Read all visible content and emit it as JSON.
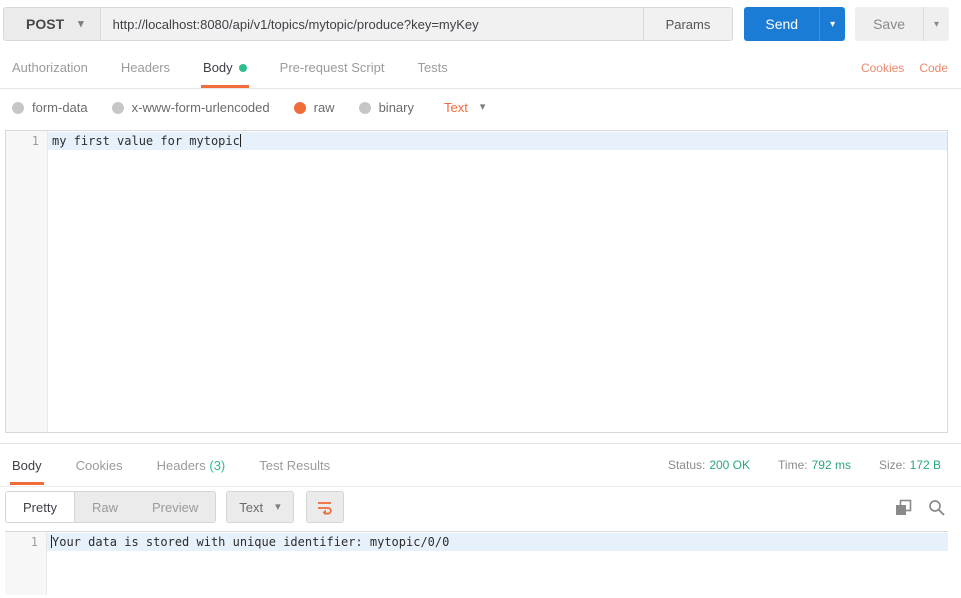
{
  "colors": {
    "accent_orange": "#f26b3a",
    "send_blue": "#1b7cd6",
    "green": "#2dbe8d"
  },
  "icons": {
    "caret_down": "▾"
  },
  "request_bar": {
    "method": "POST",
    "url": "http://localhost:8080/api/v1/topics/mytopic/produce?key=myKey",
    "params_label": "Params",
    "send_label": "Send",
    "save_label": "Save"
  },
  "request_tabs": {
    "authorization": "Authorization",
    "headers": "Headers",
    "body": "Body",
    "pre_request": "Pre-request Script",
    "tests": "Tests",
    "cookies_link": "Cookies",
    "code_link": "Code"
  },
  "body_type": {
    "form_data": "form-data",
    "urlencoded": "x-www-form-urlencoded",
    "raw": "raw",
    "binary": "binary",
    "selected": "raw",
    "format_selected": "Text"
  },
  "request_editor": {
    "line_number": "1",
    "content": "my first value for mytopic"
  },
  "response": {
    "tabs": {
      "body": "Body",
      "cookies": "Cookies",
      "headers": "Headers",
      "headers_count": "(3)",
      "test_results": "Test Results"
    },
    "meta": {
      "status_label": "Status:",
      "status_value": "200 OK",
      "time_label": "Time:",
      "time_value": "792 ms",
      "size_label": "Size:",
      "size_value": "172 B"
    },
    "view_modes": {
      "pretty": "Pretty",
      "raw": "Raw",
      "preview": "Preview",
      "active": "Pretty"
    },
    "format_selected": "Text",
    "editor": {
      "line_number": "1",
      "content": "Your data is stored with unique identifier: mytopic/0/0"
    }
  }
}
